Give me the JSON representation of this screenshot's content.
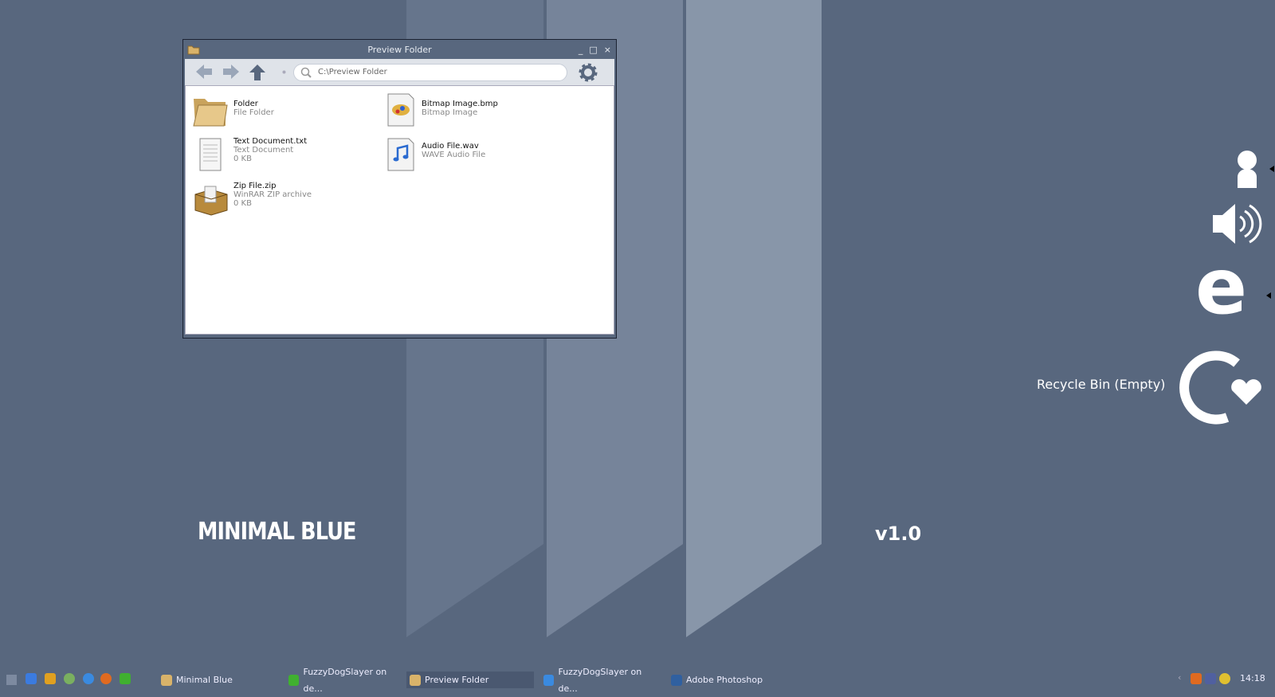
{
  "window": {
    "title": "Preview Folder",
    "address": "C:\\Preview Folder",
    "minimize": "_",
    "maximize": "□",
    "close": "×"
  },
  "files": [
    {
      "name": "Folder",
      "type": "File Folder",
      "size": "",
      "icon": "folder-icon"
    },
    {
      "name": "Bitmap Image.bmp",
      "type": "Bitmap Image",
      "size": "",
      "icon": "paint-icon"
    },
    {
      "name": "Text Document.txt",
      "type": "Text Document",
      "size": "0 KB",
      "icon": "text-file-icon"
    },
    {
      "name": "Audio File.wav",
      "type": "WAVE Audio File",
      "size": "",
      "icon": "audio-file-icon"
    },
    {
      "name": "Zip File.zip",
      "type": "WinRAR ZIP archive",
      "size": "0 KB",
      "icon": "zip-box-icon"
    }
  ],
  "desktop": {
    "brand": "MINIMAL BLUE",
    "version": "v1.0",
    "recycle_label": "Recycle Bin (Empty)"
  },
  "taskbar": {
    "tasks": [
      "Minimal Blue",
      "FuzzyDogSlayer on de...",
      "Preview Folder",
      "FuzzyDogSlayer on de...",
      "Adobe Photoshop"
    ],
    "clock": "14:18",
    "tray_expand": "‹"
  },
  "colors": {
    "background": "#58677e",
    "active_task": "#4a5870"
  }
}
